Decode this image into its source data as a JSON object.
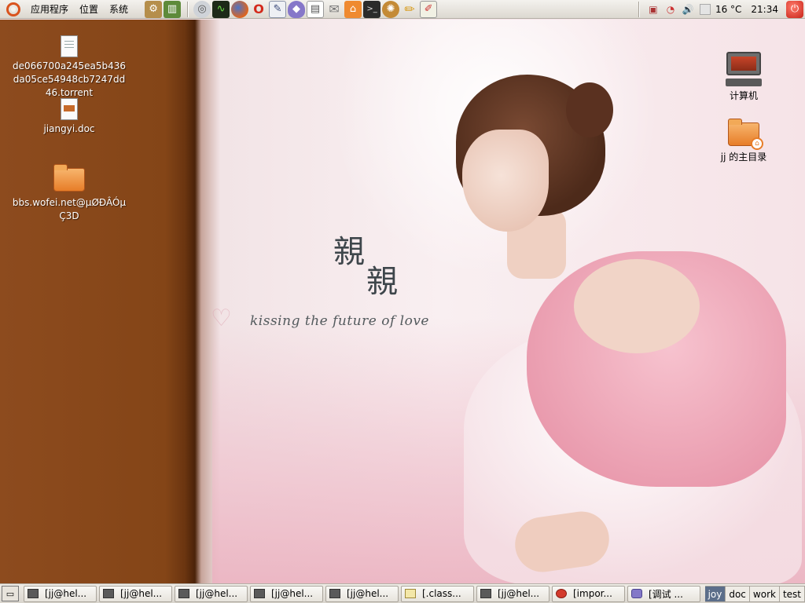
{
  "top_panel": {
    "menus": [
      {
        "label": "应用程序"
      },
      {
        "label": "位置"
      },
      {
        "label": "系统"
      }
    ],
    "launchers": [
      {
        "name": "system-tools-icon",
        "glyph": "⚙"
      },
      {
        "name": "dictionary-icon",
        "glyph": "📗"
      },
      {
        "name": "cd-drive-icon",
        "glyph": "◎"
      },
      {
        "name": "system-monitor-icon",
        "glyph": "∿"
      },
      {
        "name": "firefox-icon",
        "glyph": "◉"
      },
      {
        "name": "opera-icon",
        "glyph": "O"
      },
      {
        "name": "text-editor-icon",
        "glyph": "✎"
      },
      {
        "name": "pidgin-icon",
        "glyph": "◆"
      },
      {
        "name": "notes-icon",
        "glyph": "▤"
      },
      {
        "name": "mail-icon",
        "glyph": "✉"
      },
      {
        "name": "home-folder-icon",
        "glyph": "⌂"
      },
      {
        "name": "terminal-icon",
        "glyph": "▣"
      },
      {
        "name": "gimp-icon",
        "glyph": "✺"
      },
      {
        "name": "pencil-icon",
        "glyph": "✏"
      },
      {
        "name": "edit-icon",
        "glyph": "✐"
      }
    ],
    "tray": {
      "temperature": "16 °C",
      "clock": "21:34"
    }
  },
  "wallpaper": {
    "title_chars": [
      "親",
      "親"
    ],
    "tagline": "kissing the future of love"
  },
  "desktop_icons": [
    {
      "label": "de066700a245ea5b436da05ce54948cb7247dd46.torrent",
      "type": "document"
    },
    {
      "label": "jiangyi.doc",
      "type": "word-document"
    },
    {
      "label": "bbs.wofei.net@µØÐÂÓµÇ3D",
      "type": "folder"
    },
    {
      "label": "计算机",
      "type": "computer"
    },
    {
      "label": "jj 的主目录",
      "type": "home-folder"
    }
  ],
  "taskbar": {
    "tasks": [
      {
        "label": "[jj@hel...",
        "icon": "terminal-icon"
      },
      {
        "label": "[jj@hel...",
        "icon": "terminal-icon"
      },
      {
        "label": "[jj@hel...",
        "icon": "terminal-icon"
      },
      {
        "label": "[jj@hel...",
        "icon": "terminal-icon"
      },
      {
        "label": "[jj@hel...",
        "icon": "terminal-icon"
      },
      {
        "label": "[.class...",
        "icon": "text-editor-icon"
      },
      {
        "label": "[jj@hel...",
        "icon": "terminal-icon"
      },
      {
        "label": "[impor...",
        "icon": "opera-icon"
      },
      {
        "label": "[调试 ...",
        "icon": "chat-icon"
      }
    ],
    "workspaces": [
      {
        "label": "joy",
        "active": true
      },
      {
        "label": "doc",
        "active": false
      },
      {
        "label": "work",
        "active": false
      },
      {
        "label": "test",
        "active": false
      }
    ]
  }
}
